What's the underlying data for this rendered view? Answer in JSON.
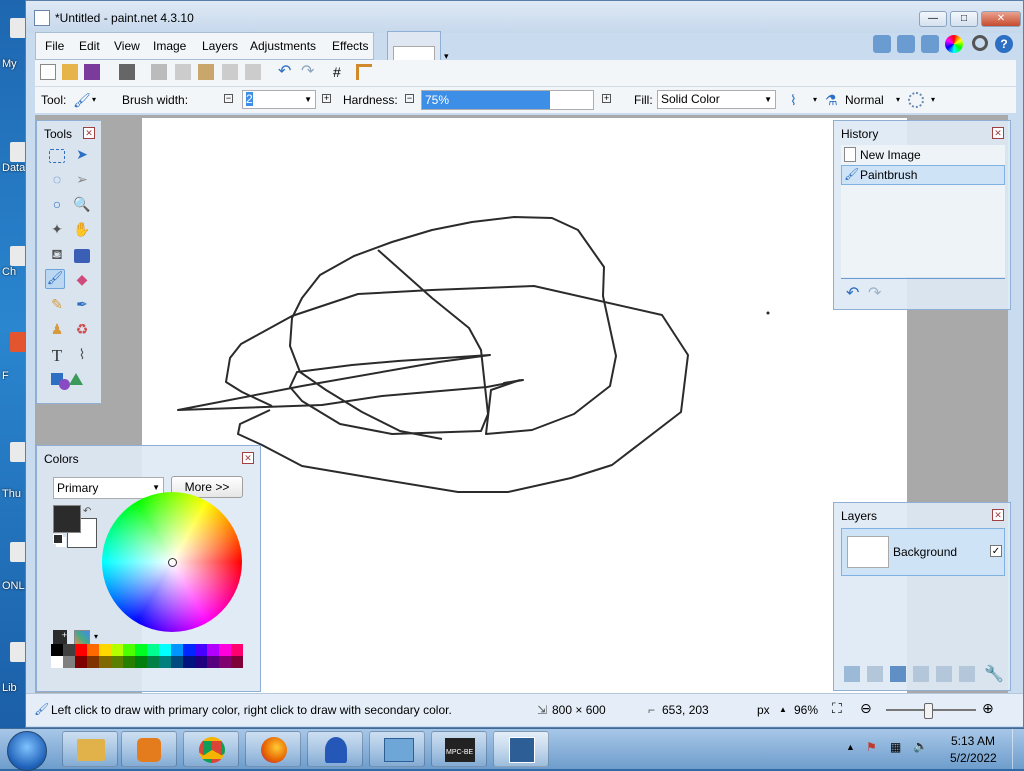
{
  "window": {
    "title": "*Untitled - paint.net 4.3.10",
    "minimize": "—",
    "maximize": "□",
    "close": "✕"
  },
  "menu": [
    "File",
    "Edit",
    "View",
    "Image",
    "Layers",
    "Adjustments",
    "Effects"
  ],
  "toolbar": {
    "tool_label": "Tool:",
    "brush_width_label": "Brush width:",
    "brush_width_value": "2",
    "hardness_label": "Hardness:",
    "hardness_value": "75%",
    "hardness_fraction": 0.75,
    "fill_label": "Fill:",
    "fill_value": "Solid Color",
    "blend_mode": "Normal"
  },
  "tools_panel": {
    "title": "Tools",
    "active_tool": "paintbrush"
  },
  "colors_panel": {
    "title": "Colors",
    "target": "Primary",
    "more_button": "More >>",
    "primary_color": "#2b2b2b",
    "secondary_color": "#ffffff"
  },
  "history_panel": {
    "title": "History",
    "items": [
      {
        "label": "New Image",
        "selected": false
      },
      {
        "label": "Paintbrush",
        "selected": true
      }
    ]
  },
  "layers_panel": {
    "title": "Layers",
    "layers": [
      {
        "name": "Background",
        "visible": true
      }
    ]
  },
  "statusbar": {
    "hint": "Left click to draw with primary color, right click to draw with secondary color.",
    "image_size": "800 × 600",
    "cursor_pos": "653, 203",
    "units": "px",
    "zoom": "96%"
  },
  "taskbar": {
    "time": "5:13 AM",
    "date": "5/2/2022",
    "mpc_label": "MPC-BE"
  },
  "desktop_icons": [
    "My",
    "Data",
    "Ch",
    "F",
    "Thu",
    "ONL E",
    "Lib"
  ]
}
